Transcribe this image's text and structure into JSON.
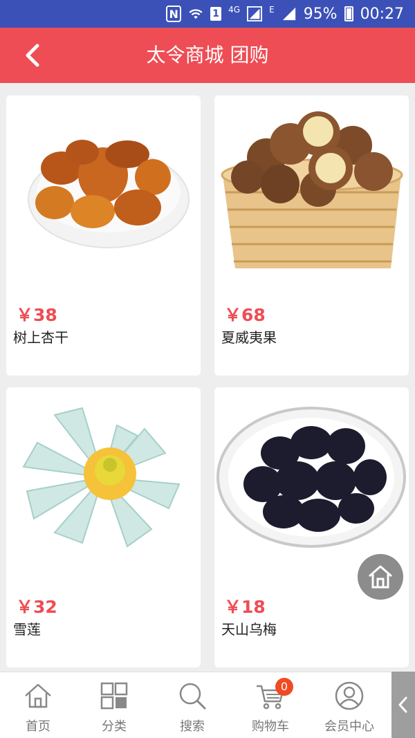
{
  "status_bar": {
    "network_4g": "4G",
    "network_e": "E",
    "sim": "1",
    "nfc": "N",
    "battery": "95%",
    "time": "00:27"
  },
  "header": {
    "title": "太令商城 团购"
  },
  "products": [
    {
      "price": "￥38",
      "name": "树上杏干"
    },
    {
      "price": "￥68",
      "name": "夏威夷果"
    },
    {
      "price": "￥32",
      "name": "雪莲"
    },
    {
      "price": "￥18",
      "name": "天山乌梅"
    }
  ],
  "bottom_nav": [
    {
      "label": "首页",
      "icon": "home-icon"
    },
    {
      "label": "分类",
      "icon": "grid-icon"
    },
    {
      "label": "搜索",
      "icon": "search-icon"
    },
    {
      "label": "购物车",
      "icon": "cart-icon",
      "badge": "0"
    },
    {
      "label": "会员中心",
      "icon": "user-icon"
    }
  ],
  "colors": {
    "status_bar": "#3b51b8",
    "header": "#ee4d55",
    "price": "#ee4d55",
    "badge": "#f04a24"
  }
}
